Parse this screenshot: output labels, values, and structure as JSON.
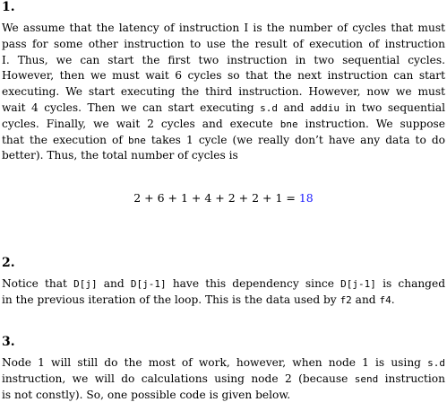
{
  "section1": {
    "heading": "1.",
    "lines": [
      "We assume that the latency of instruction I is the number of cycles that must",
      "pass for some other instruction to use the result of execution of instruction",
      "I. Thus, we can start the first two instruction in two sequential cycles.",
      "However, then we must wait 6 cycles so that the next instruction can start",
      "executing. We start executing the third instruction. However, now we must"
    ],
    "line6_a": "wait 4 cycles. Then we can start executing ",
    "line6_code1": "s.d",
    "line6_b": " and ",
    "line6_code2": "addiu",
    "line6_c": " in two sequential",
    "line7_a": "cycles. Finally, we wait 2 cycles and execute ",
    "line7_code": "bne",
    "line7_b": " instruction. We suppose",
    "line8_a": "that the execution of ",
    "line8_code": "bne",
    "line8_b": " takes 1 cycle (we really don’t have any data to do",
    "line9": "better). Thus, the total number of cycles is",
    "equation": "2 + 6 + 1 + 4 + 2 + 2 + 1 = ",
    "equation_result": "18"
  },
  "section2": {
    "heading": "2.",
    "line1_a": "Notice that ",
    "line1_code1": "D[j]",
    "line1_b": " and ",
    "line1_code2": "D[j-1]",
    "line1_c": " have this dependency since ",
    "line1_code3": "D[j-1]",
    "line1_d": " is changed",
    "line2_a": "in the previous iteration of the loop. This is the data used by ",
    "line2_code1": "f2",
    "line2_b": " and ",
    "line2_code2": "f4",
    "line2_c": "."
  },
  "section3": {
    "heading": "3.",
    "line1_a": "Node 1 will still do the most of work, however, when node 1 is using ",
    "line1_code": "s.d",
    "line2_a": "instruction, we will do calculations using node 2 (because ",
    "line2_code": "send",
    "line2_b": " instruction",
    "line3": "is not constly). So, one possible code is given below."
  }
}
